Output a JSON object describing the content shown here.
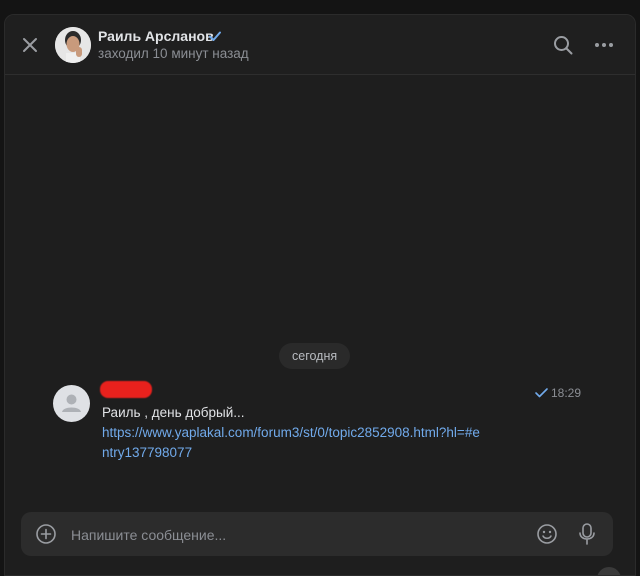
{
  "header": {
    "contact_name": "Раиль Арсланов",
    "last_seen": "заходил 10 минут назад"
  },
  "chat": {
    "date_divider": "сегодня",
    "message": {
      "time": "18:29",
      "text": "Раиль , день добрый...",
      "link": "https://www.yaplakal.com/forum3/st/0/topic2852908.html?hl=#entry137798077"
    }
  },
  "composer": {
    "placeholder": "Напишите сообщение..."
  },
  "colors": {
    "accent": "#71aaeb",
    "background": "#1e1e1e",
    "redaction": "#e8211d"
  }
}
